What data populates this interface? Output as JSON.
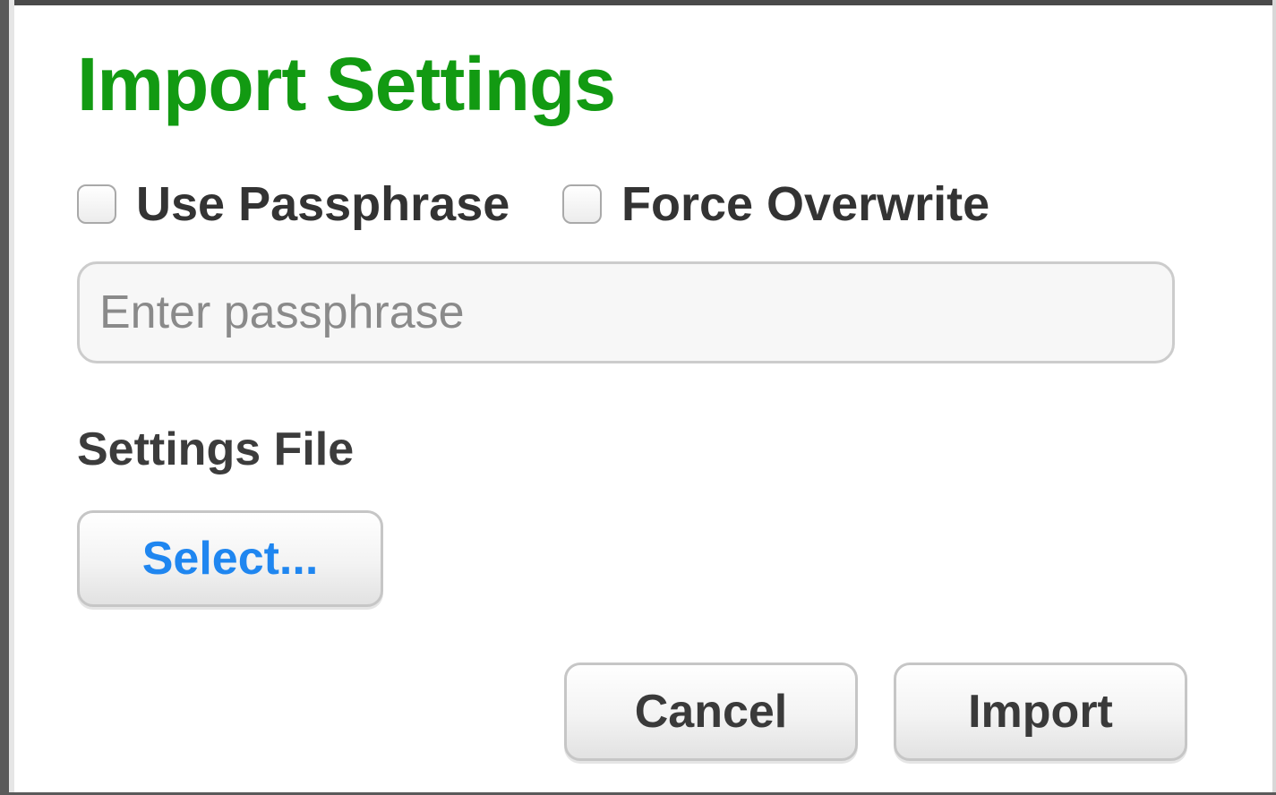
{
  "dialog": {
    "title": "Import Settings",
    "title_color": "#129a12",
    "options": {
      "use_passphrase_label": "Use Passphrase",
      "use_passphrase_checked": false,
      "force_overwrite_label": "Force Overwrite",
      "force_overwrite_checked": false
    },
    "passphrase": {
      "placeholder": "Enter passphrase",
      "value": ""
    },
    "settings_file": {
      "label": "Settings File",
      "select_button_label": "Select...",
      "select_button_color": "#1f86f0"
    },
    "actions": {
      "cancel_label": "Cancel",
      "import_label": "Import"
    }
  }
}
